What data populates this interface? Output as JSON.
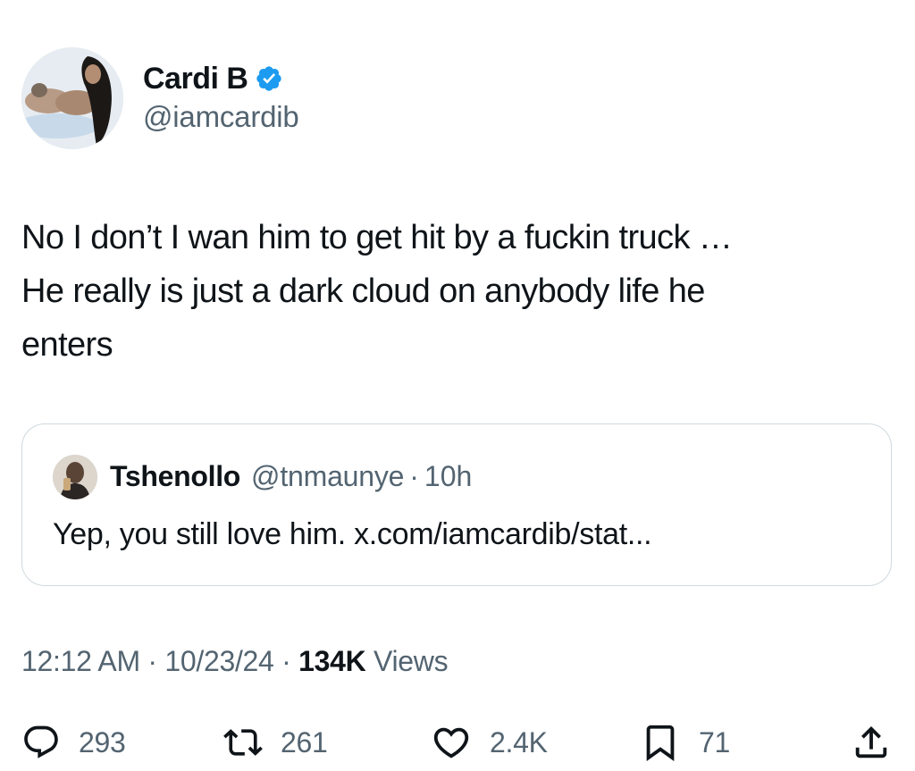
{
  "author": {
    "display_name": "Cardi B",
    "handle": "@iamcardib",
    "verified": true
  },
  "tweet": {
    "text": "No I don’t I wan him to get hit by a fuckin truck …\nHe really is just a dark cloud on anybody life he\nenters"
  },
  "quoted_tweet": {
    "display_name": "Tshenollo",
    "handle": "@tnmaunye",
    "separator": "·",
    "time": "10h",
    "text": "Yep, you still love him. x.com/iamcardib/stat..."
  },
  "meta": {
    "time": "12:12 AM",
    "separator_1": "·",
    "date": "10/23/24",
    "separator_2": "·",
    "views_count": "134K",
    "views_label": "Views"
  },
  "actions": {
    "replies": "293",
    "reposts": "261",
    "likes": "2.4K",
    "bookmarks": "71"
  },
  "colors": {
    "text_primary": "#0f1419",
    "text_secondary": "#536471",
    "verified_blue": "#1d9bf0",
    "border": "#cfd9de"
  },
  "icons": {
    "verified": "verified-badge-icon",
    "reply": "reply-icon",
    "repost": "repost-icon",
    "like": "heart-icon",
    "bookmark": "bookmark-icon",
    "share": "share-icon"
  }
}
